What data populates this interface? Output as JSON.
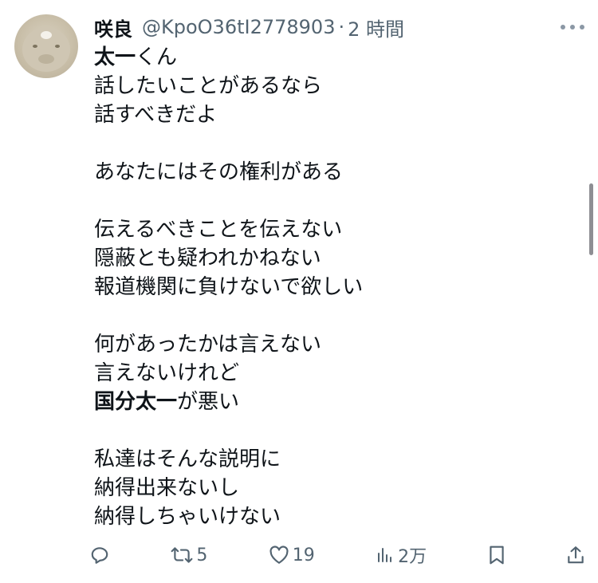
{
  "tweet": {
    "display_name": "咲良",
    "handle": "@KpoO36tI2778903",
    "separator": "·",
    "time": "2 時間",
    "lines": [
      {
        "text": "太一くん",
        "bold": "太一"
      },
      {
        "text": "話したいことがあるなら"
      },
      {
        "text": "話すべきだよ"
      },
      {
        "text": ""
      },
      {
        "text": "あなたにはその権利がある"
      },
      {
        "text": ""
      },
      {
        "text": "伝えるべきことを伝えない"
      },
      {
        "text": "隠蔽とも疑われかねない"
      },
      {
        "text": "報道機関に負けないで欲しい"
      },
      {
        "text": ""
      },
      {
        "text": "何があったかは言えない"
      },
      {
        "text": "言えないけれど"
      },
      {
        "text": "国分太一が悪い",
        "bold": "国分太一"
      },
      {
        "text": ""
      },
      {
        "text": "私達はそんな説明に"
      },
      {
        "text": "納得出来ないし"
      },
      {
        "text": "納得しちゃいけない"
      }
    ]
  },
  "actions": {
    "reply_icon": "reply-icon",
    "retweet_icon": "retweet-icon",
    "retweet_count": "5",
    "like_icon": "heart-icon",
    "like_count": "19",
    "views_icon": "bar-chart-icon",
    "views_count": "2万",
    "bookmark_icon": "bookmark-icon",
    "share_icon": "share-icon"
  },
  "colors": {
    "text": "#0f1419",
    "secondary": "#536471"
  }
}
